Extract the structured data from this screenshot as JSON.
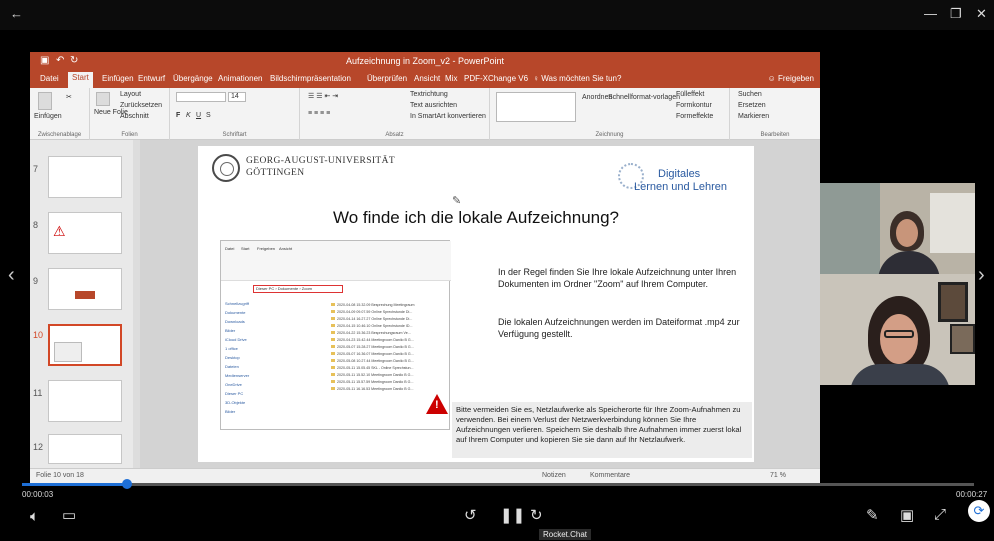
{
  "window": {
    "back_glyph": "←",
    "min_glyph": "—",
    "max_glyph": "❐",
    "close_glyph": "✕"
  },
  "ppt": {
    "title": "Aufzeichnung in Zoom_v2 - PowerPoint",
    "tabs": [
      "Datei",
      "Start",
      "Einfügen",
      "Entwurf",
      "Übergänge",
      "Animationen",
      "Bildschirmpräsentation",
      "Überprüfen",
      "Ansicht",
      "Mix",
      "PDF-XChange V6"
    ],
    "tell_me": "Was möchten Sie tun?",
    "share": "Freigeben",
    "ribbon": {
      "paste": "Einfügen",
      "new_slide": "Neue Folie",
      "layout": "Layout",
      "reset": "Zurücksetzen",
      "section": "Abschnitt",
      "g_clipboard": "Zwischenablage",
      "g_slides": "Folien",
      "g_font": "Schriftart",
      "g_paragraph": "Absatz",
      "g_drawing": "Zeichnung",
      "g_edit": "Bearbeiten",
      "text_dir": "Textrichtung",
      "align_text": "Text ausrichten",
      "smartart": "In SmartArt konvertieren",
      "arrange": "Anordnen",
      "quick_styles": "Schnellformat-vorlagen",
      "fill": "Fülleffekt",
      "outline": "Formkontur",
      "effects": "Formeffekte",
      "search": "Suchen",
      "replace": "Ersetzen",
      "select": "Markieren",
      "font_bold": "F",
      "font_italic": "K",
      "font_underline": "U",
      "font_strike": "S",
      "font_size": "14"
    },
    "thumbnails": [
      "7",
      "8",
      "9",
      "10",
      "11",
      "12"
    ],
    "status": {
      "slide_info": "Folie 10 von 18",
      "notes": "Notizen",
      "comments": "Kommentare",
      "zoom": "71 %"
    },
    "slide": {
      "uni_line1": "GEORG-AUGUST-UNIVERSITÄT",
      "uni_line2": "GÖTTINGEN",
      "dl_line1": "Digitales",
      "dl_line2": "Lernen und Lehren",
      "title": "Wo finde ich die lokale Aufzeichnung?",
      "para1": "In der Regel finden Sie Ihre lokale Aufzeichnung unter Ihren Dokumenten im Ordner \"Zoom\" auf Ihrem Computer.",
      "para2": "Die lokalen Aufzeichnungen werden im Dateiformat .mp4 zur Verfügung gestellt.",
      "warning": "Bitte vermeiden Sie es, Netzlaufwerke als Speicherorte für Ihre Zoom-Aufnahmen zu verwenden. Bei einem Verlust der Netzwerkverbindung können Sie Ihre Aufzeichnungen verlieren. Speichern Sie deshalb Ihre Aufnahmen immer zuerst lokal auf Ihrem Computer und kopieren Sie sie dann auf Ihr Netzlaufwerk.",
      "explorer": {
        "tabs": [
          "Datei",
          "Start",
          "Freigeben",
          "Ansicht"
        ],
        "path": "Dieser PC › Dokumente › Zoom",
        "nav": [
          "Schnellzugriff",
          "Dokumente",
          "Downloads",
          "Bilder",
          "iCloud Drive",
          "1 office",
          "Desktop",
          "Dateien",
          "Medienserver",
          "OneDrive",
          "Dieser PC",
          "3D-Objekte",
          "Bilder"
        ],
        "files": [
          "2020-04-08 15.32.09 Besprechung Meetingraum",
          "2020-04-09 09.07.59 Online Sprechstunde Di...",
          "2020-04-14 16.27.27 Online Sprechstunde Di...",
          "2020-04-15 10.46.10 Online Sprechstunde ID...",
          "2020-04-22 15.36.23 Besprechungsraum Ve...",
          "2020-04-23 15.42.44 Meetingroom Danilo B G...",
          "2020-05-07 15.28.27 Meetingroom Danilo B G...",
          "2020-05-07 16.36.07 Meetingroom Danilo B G...",
          "2020-05-08 10.27.44 Meetingroom Danilo B G...",
          "2020-05-11 15.05.45 SKL - Online Sprechstun...",
          "2020-05-11 15.52.10 Meetingroom Danilo B G...",
          "2020-05-11 15.57.59 Meetingroom Danilo B G...",
          "2020-05-11 16.16.53 Meetingroom Danilo B G..."
        ]
      }
    }
  },
  "player": {
    "time_current": "00:00:03",
    "time_total": "00:00:27",
    "progress": 0.11,
    "tooltip": "Rocket.Chat",
    "nav_prev": "‹",
    "nav_next": "›"
  }
}
